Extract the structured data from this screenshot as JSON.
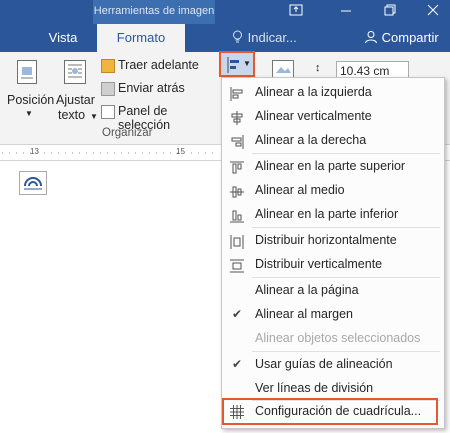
{
  "titlebar": {
    "context_tab": "Herramientas de imagen"
  },
  "tabs": [
    {
      "label": "Vista"
    },
    {
      "label": "Formato"
    }
  ],
  "search": {
    "label": "Indicar..."
  },
  "share": {
    "label": "Compartir"
  },
  "ribbon": {
    "posicion": "Posición",
    "ajustar_1": "Ajustar",
    "ajustar_2": "texto",
    "traer": "Traer adelante",
    "enviar": "Enviar atrás",
    "panel": "Panel de selección",
    "group": "Organizar",
    "width_value": "10.43 cm"
  },
  "ruler": {
    "t1": "13",
    "t2": "15"
  },
  "menu": {
    "items": [
      {
        "label": "Alinear a la izquierda",
        "icon": "align-left-icon"
      },
      {
        "label": "Alinear verticalmente",
        "icon": "align-center-icon"
      },
      {
        "label": "Alinear a la derecha",
        "icon": "align-right-icon"
      },
      {
        "label": "Alinear en la parte superior",
        "icon": "align-top-icon"
      },
      {
        "label": "Alinear al medio",
        "icon": "align-middle-icon"
      },
      {
        "label": "Alinear en la parte inferior",
        "icon": "align-bottom-icon"
      },
      {
        "label": "Distribuir horizontalmente",
        "icon": "distribute-horizontal-icon"
      },
      {
        "label": "Distribuir verticalmente",
        "icon": "distribute-vertical-icon"
      },
      {
        "label": "Alinear a la página"
      },
      {
        "label": "Alinear al margen",
        "checked": true
      },
      {
        "label": "Alinear objetos seleccionados",
        "disabled": true
      },
      {
        "label": "Usar guías de alineación",
        "checked": true
      },
      {
        "label": "Ver líneas de división"
      },
      {
        "label": "Configuración de cuadrícula...",
        "icon": "grid-icon"
      }
    ]
  },
  "colors": {
    "brand": "#2b579a",
    "highlight": "#e25a2e"
  }
}
